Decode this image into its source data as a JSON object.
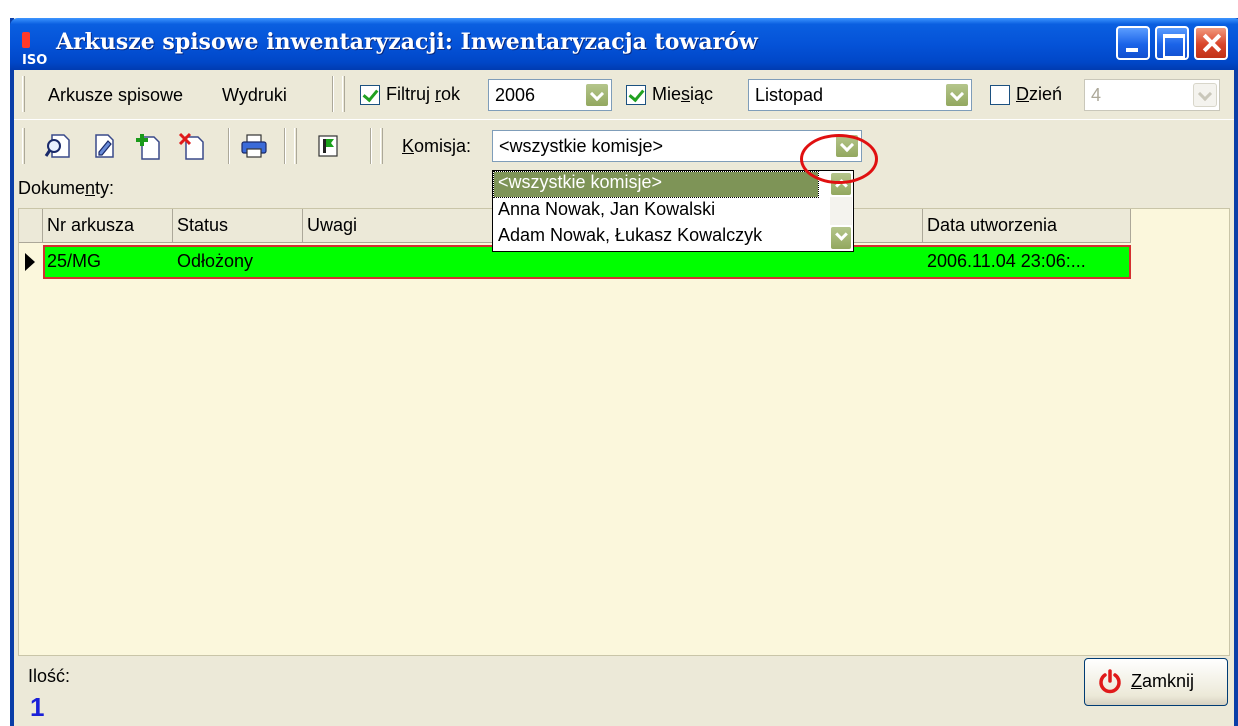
{
  "window": {
    "title": "Arkusze spisowe inwentaryzacji: Inwentaryzacja towarów",
    "app_icon": "ISO",
    "controls": [
      "minimize-icon",
      "maximize-icon",
      "close-icon"
    ]
  },
  "menu": {
    "items": [
      "Arkusze spisowe",
      "Wydruki"
    ]
  },
  "filters": {
    "year": {
      "label_pre": "Filtruj ",
      "label_u": "r",
      "label_post": "ok",
      "checked": true,
      "value": "2006"
    },
    "month": {
      "label_pre": "Mie",
      "label_u": "s",
      "label_post": "iąc",
      "checked": true,
      "value": "Listopad"
    },
    "day": {
      "label_pre": "",
      "label_u": "D",
      "label_post": "zień",
      "checked": false,
      "value": "4"
    }
  },
  "toolbar": {
    "icons": [
      "view-document-icon",
      "edit-document-icon",
      "add-document-icon",
      "delete-document-icon",
      "print-icon",
      "flag-icon"
    ],
    "komisja": {
      "label_u": "K",
      "label_post": "omisja:",
      "value": "<wszystkie komisje>"
    }
  },
  "dropdown": {
    "options": [
      "<wszystkie komisje>",
      "Anna Nowak, Jan Kowalski",
      "Adam Nowak, Łukasz Kowalczyk"
    ],
    "selected_index": 0
  },
  "documents": {
    "label_pre": "Dokume",
    "label_u": "n",
    "label_post": "ty:",
    "columns": [
      "Nr arkusza",
      "Status",
      "Uwagi",
      "",
      "Data utworzenia"
    ],
    "rows": [
      {
        "nr": "25/MG",
        "status": "Odłożony",
        "uwagi": "",
        "data": "2006.11.04 23:06:..."
      }
    ],
    "row_color": "#00ff00"
  },
  "footer": {
    "count_label": "Ilość:",
    "count_value": "1",
    "close_label_u": "Z",
    "close_label_post": "amknij"
  },
  "colors": {
    "titlebar": "#0553d8",
    "accent_green": "#93a85f",
    "highlight_ring": "#e01010",
    "count": "#1a20d8"
  }
}
